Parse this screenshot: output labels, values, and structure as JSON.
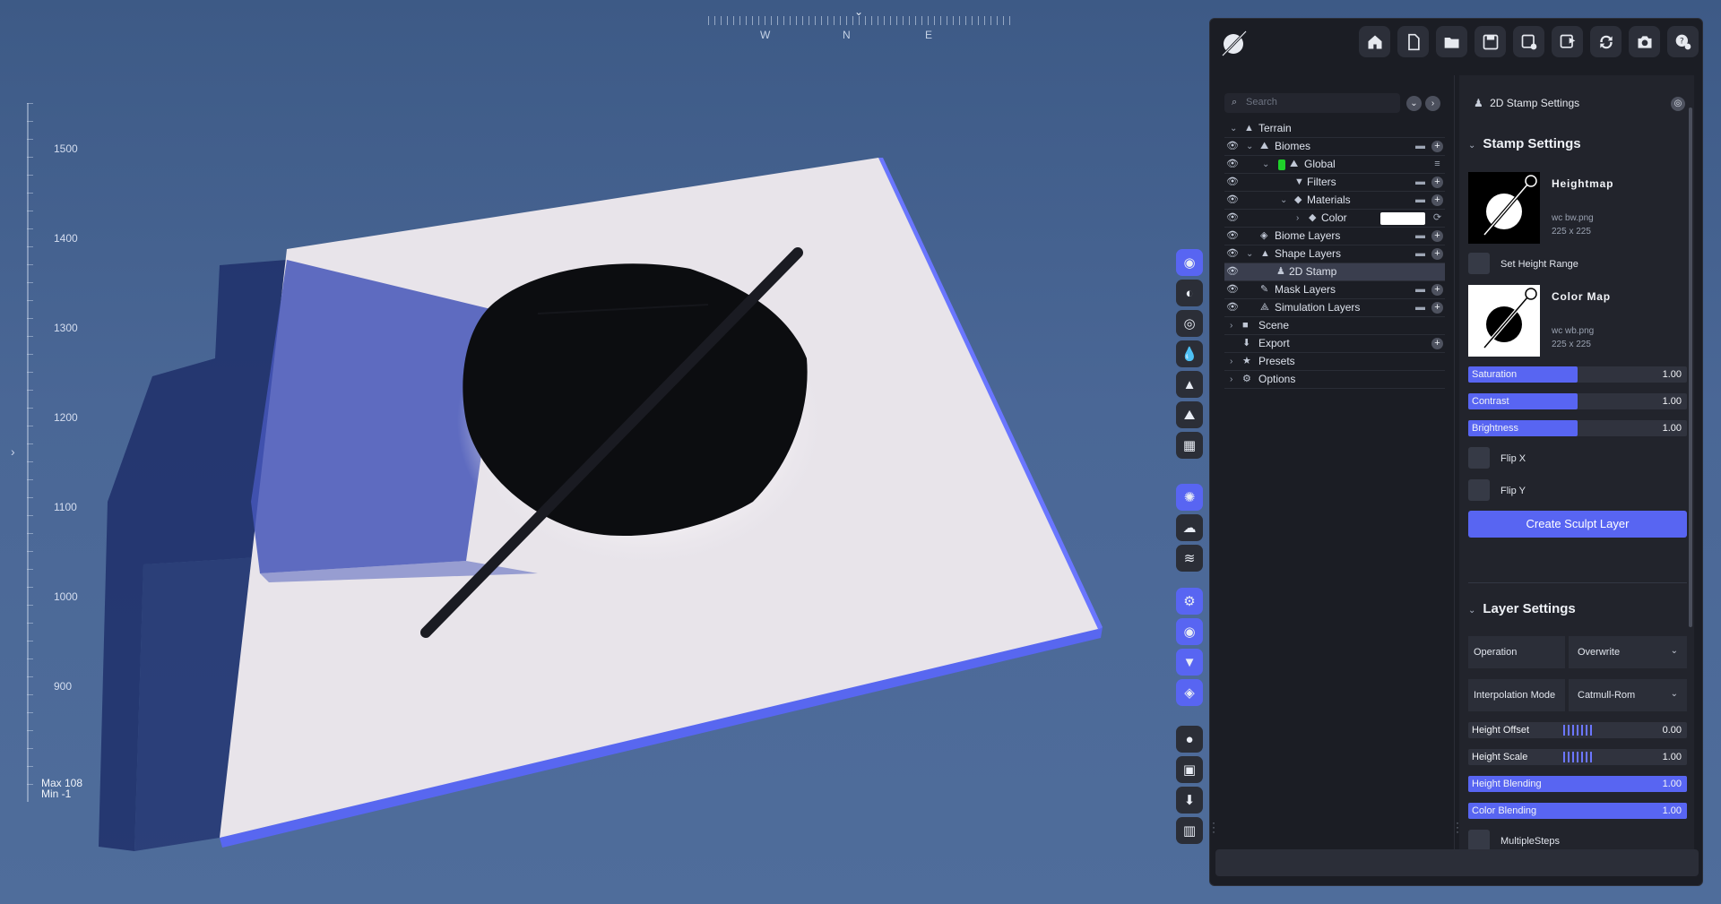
{
  "viewport": {
    "compass": {
      "marker": "⌄",
      "directions": [
        "W",
        "N",
        "E"
      ]
    },
    "ruler_labels": [
      "1500",
      "1400",
      "1300",
      "1200",
      "1100",
      "1000",
      "900"
    ],
    "height_max": "Max 108",
    "height_min": "Min -1",
    "expand_chevron": "›"
  },
  "toolstrip": [
    {
      "name": "terrain-tool-icon",
      "glyph": "◉",
      "active": true
    },
    {
      "name": "globe-tool-icon",
      "glyph": "◐",
      "active": false
    },
    {
      "name": "target-tool-icon",
      "glyph": "◎",
      "active": false
    },
    {
      "name": "water-drop-icon",
      "glyph": "💧",
      "active": false
    },
    {
      "name": "mountain-icon",
      "glyph": "▲",
      "active": false
    },
    {
      "name": "landscape-icon",
      "glyph": "⛰",
      "active": false
    },
    {
      "name": "grid-icon",
      "glyph": "▦",
      "active": false
    },
    {
      "name": "sun-icon",
      "glyph": "✺",
      "active": true
    },
    {
      "name": "cloud-icon",
      "glyph": "☁",
      "active": false
    },
    {
      "name": "fog-icon",
      "glyph": "≋",
      "active": false
    },
    {
      "name": "gears-icon",
      "glyph": "⚙",
      "active": true
    },
    {
      "name": "eye-icon",
      "glyph": "◉",
      "active": true
    },
    {
      "name": "filter-icon",
      "glyph": "▼",
      "active": true
    },
    {
      "name": "layers-icon",
      "glyph": "◈",
      "active": true
    },
    {
      "name": "record-icon",
      "glyph": "●",
      "active": false
    },
    {
      "name": "image-icon",
      "glyph": "▣",
      "active": false
    },
    {
      "name": "download-icon",
      "glyph": "⬇",
      "active": false
    },
    {
      "name": "stats-icon",
      "glyph": "▥",
      "active": false
    }
  ],
  "panel": {
    "top_icons": [
      "home-icon",
      "new-file-icon",
      "open-folder-icon",
      "save-icon",
      "save-as-icon",
      "export-icon",
      "refresh-icon",
      "camera-icon",
      "help-icon"
    ],
    "search": {
      "placeholder": "Search"
    },
    "tree": [
      {
        "label": "Terrain"
      },
      {
        "label": "Biomes"
      },
      {
        "label": "Global"
      },
      {
        "label": "Filters"
      },
      {
        "label": "Materials"
      },
      {
        "label": "Color"
      },
      {
        "label": "Biome Layers"
      },
      {
        "label": "Shape Layers"
      },
      {
        "label": "2D Stamp"
      },
      {
        "label": "Mask Layers"
      },
      {
        "label": "Simulation Layers"
      },
      {
        "label": "Scene"
      },
      {
        "label": "Export"
      },
      {
        "label": "Presets"
      },
      {
        "label": "Options"
      }
    ],
    "colors": {
      "accent": "#5865f2",
      "global_tag": "#1fd12a",
      "swatch": "#ffffff"
    },
    "settings": {
      "title": "2D Stamp Settings",
      "stamp_section": "Stamp Settings",
      "heightmap": {
        "name": "Heightmap",
        "file": "wc bw.png",
        "size": "225 x 225"
      },
      "set_height_range": "Set Height Range",
      "colormap": {
        "name": "Color Map",
        "file": "wc wb.png",
        "size": "225 x 225"
      },
      "saturation": {
        "label": "Saturation",
        "value": "1.00",
        "fill": 0.5
      },
      "contrast": {
        "label": "Contrast",
        "value": "1.00",
        "fill": 0.5
      },
      "brightness": {
        "label": "Brightness",
        "value": "1.00",
        "fill": 0.5
      },
      "flip_x": "Flip X",
      "flip_y": "Flip Y",
      "create_button": "Create Sculpt Layer",
      "layer_section": "Layer Settings",
      "operation": {
        "label": "Operation",
        "value": "Overwrite"
      },
      "interpolation": {
        "label": "Interpolation Mode",
        "value": "Catmull-Rom"
      },
      "height_offset": {
        "label": "Height Offset",
        "value": "0.00"
      },
      "height_scale": {
        "label": "Height Scale",
        "value": "1.00"
      },
      "height_blending": {
        "label": "Height Blending",
        "value": "1.00",
        "fill": 1.0
      },
      "color_blending": {
        "label": "Color Blending",
        "value": "1.00",
        "fill": 1.0
      },
      "multiple_steps": "MultipleSteps"
    }
  }
}
